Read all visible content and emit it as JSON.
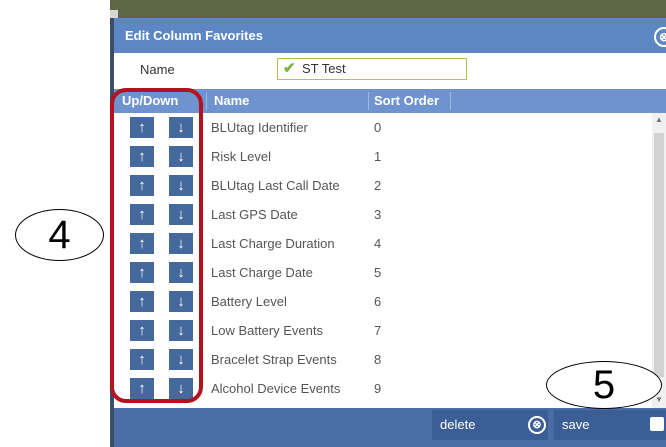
{
  "dialog": {
    "title": "Edit Column Favorites",
    "close_glyph": "⊗",
    "name_label": "Name",
    "name_value": "ST Test",
    "check_glyph": "✔"
  },
  "columns": {
    "updown": "Up/Down",
    "name": "Name",
    "sort": "Sort Order"
  },
  "rows": [
    {
      "name": "BLUtag Identifier",
      "sort": "0"
    },
    {
      "name": "Risk Level",
      "sort": "1"
    },
    {
      "name": "BLUtag Last Call Date",
      "sort": "2"
    },
    {
      "name": "Last GPS Date",
      "sort": "3"
    },
    {
      "name": "Last Charge Duration",
      "sort": "4"
    },
    {
      "name": "Last Charge Date",
      "sort": "5"
    },
    {
      "name": "Battery Level",
      "sort": "6"
    },
    {
      "name": "Low Battery Events",
      "sort": "7"
    },
    {
      "name": "Bracelet Strap Events",
      "sort": "8"
    },
    {
      "name": "Alcohol Device Events",
      "sort": "9"
    }
  ],
  "icons": {
    "up": "↑",
    "down": "↓",
    "up_arrow_icon": "arrow-up-icon",
    "down_arrow_icon": "arrow-down-icon"
  },
  "footer": {
    "delete_label": "delete",
    "delete_icon": "⊗",
    "save_label": "save"
  },
  "annotations": {
    "callout_4": "4",
    "callout_5": "5"
  },
  "colors": {
    "titlebar": "#5d87c4",
    "header": "#6e93cf",
    "button": "#45689d",
    "footer": "#4b6da6",
    "highlight": "#b3121f"
  }
}
